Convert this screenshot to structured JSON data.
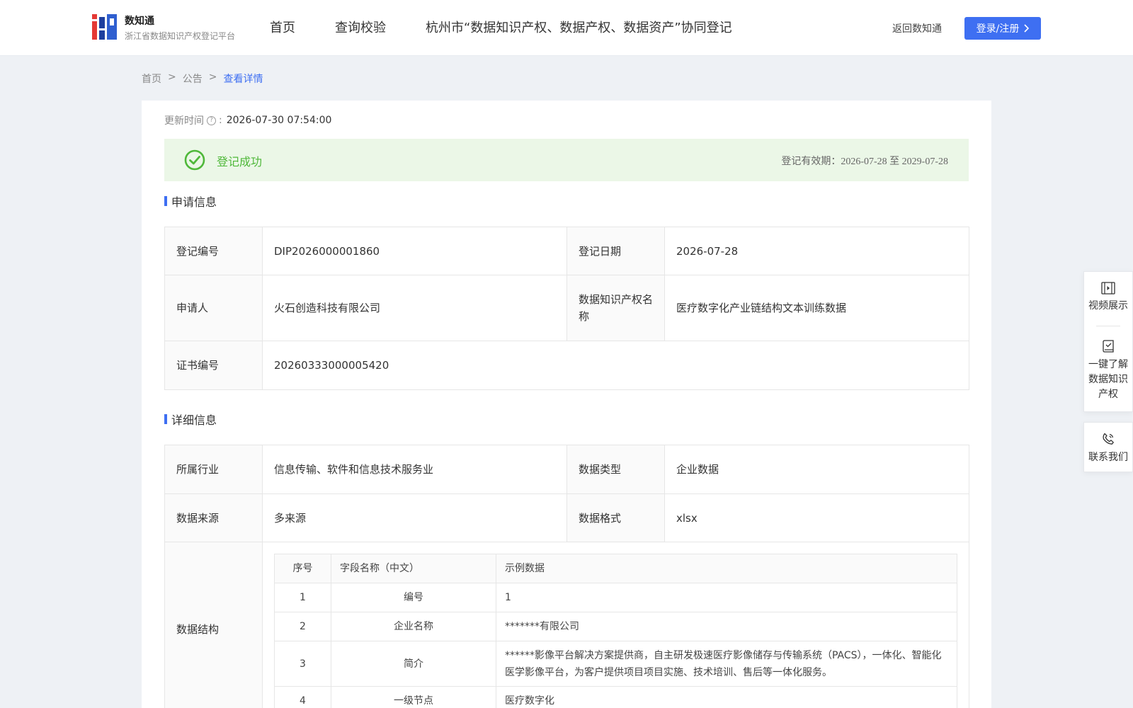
{
  "header": {
    "logo_title": "数知通",
    "logo_subtitle": "浙江省数据知识产权登记平台",
    "nav": [
      "首页",
      "查询校验",
      "杭州市“数据知识产权、数据产权、数据资产”协同登记"
    ],
    "back_label": "返回数知通",
    "login_label": "登录/注册",
    "brand_color": "#3e6ff2"
  },
  "breadcrumb": {
    "items": [
      "首页",
      "公告",
      "查看详情"
    ],
    "separator": ">"
  },
  "update": {
    "label": "更新时间",
    "colon": ":",
    "value": "2026-07-30 07:54:00"
  },
  "status": {
    "text": "登记成功",
    "validity": "登记有效期：2026-07-28 至 2029-07-28",
    "color": "#4fb83a"
  },
  "application": {
    "title": "申请信息",
    "reg_no_label": "登记编号",
    "reg_no": "DIP2026000001860",
    "reg_date_label": "登记日期",
    "reg_date": "2026-07-28",
    "applicant_label": "申请人",
    "applicant": "火石创造科技有限公司",
    "ip_name_label": "数据知识产权名称",
    "ip_name": "医疗数字化产业链结构文本训练数据",
    "cert_no_label": "证书编号",
    "cert_no": "20260333000005420"
  },
  "detail": {
    "title": "详细信息",
    "industry_label": "所属行业",
    "industry": "信息传输、软件和信息技术服务业",
    "data_type_label": "数据类型",
    "data_type": "企业数据",
    "source_label": "数据来源",
    "source": "多来源",
    "format_label": "数据格式",
    "format": "xlsx",
    "structure_label": "数据结构",
    "fields_header": {
      "no": "序号",
      "name": "字段名称（中文）",
      "sample": "示例数据"
    },
    "fields": [
      {
        "no": "1",
        "name": "编号",
        "sample": "1"
      },
      {
        "no": "2",
        "name": "企业名称",
        "sample": "*******有限公司"
      },
      {
        "no": "3",
        "name": "简介",
        "sample": "******影像平台解决方案提供商，自主研发极速医疗影像储存与传输系统（PACS），一体化、智能化医学影像平台，为客户提供项目项目实施、技术培训、售后等一体化服务。"
      },
      {
        "no": "4",
        "name": "一级节点",
        "sample": "医疗数字化"
      }
    ]
  },
  "side": {
    "video": "视频展示",
    "learn": "一键了解数据知识产权",
    "contact": "联系我们"
  }
}
